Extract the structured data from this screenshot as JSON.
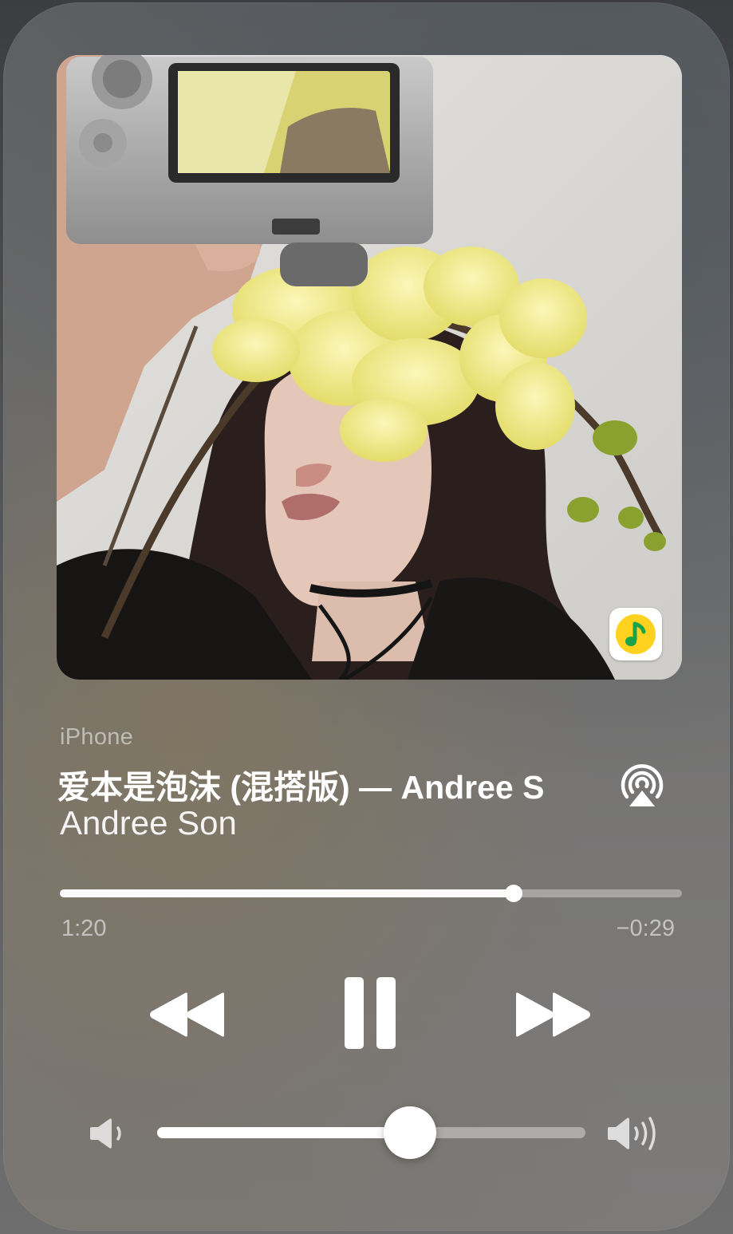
{
  "now_playing": {
    "device": "iPhone",
    "title": "爱本是泡沫 (混搭版) — Andree S",
    "artist": "Andree Son",
    "artwork_icon": "album-artwork-photo",
    "app_badge_icon": "qq-music-icon",
    "airplay_icon": "airplay-audio-icon"
  },
  "progress": {
    "elapsed": "1:20",
    "remaining": "−0:29",
    "fraction": 0.73
  },
  "transport": {
    "rewind_icon": "rewind-icon",
    "pause_icon": "pause-icon",
    "forward_icon": "fast-forward-icon"
  },
  "volume": {
    "level": 0.59,
    "low_icon": "speaker-low-icon",
    "high_icon": "speaker-high-icon"
  },
  "colors": {
    "badge_yellow": "#ffd21f",
    "badge_green": "#1aa34a",
    "text_primary": "#ffffff"
  }
}
